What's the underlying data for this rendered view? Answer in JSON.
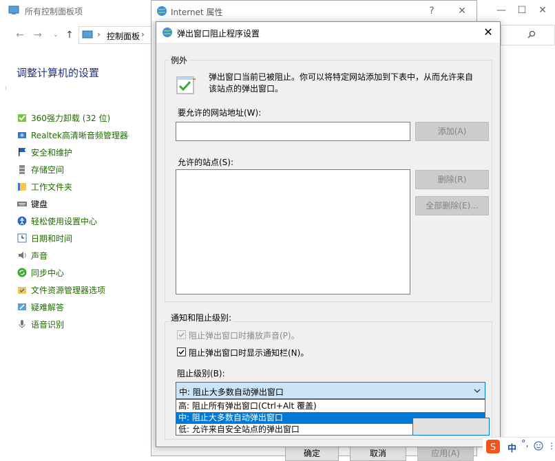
{
  "control_panel": {
    "title": "所有控制面板项",
    "breadcrumb": "控制面板",
    "heading": "调整计算机的设置",
    "items": [
      {
        "label": "360强力卸载 (32 位)",
        "icon": "uninstall-icon"
      },
      {
        "label": "Realtek高清晰音频管理器",
        "icon": "speaker-manager-icon"
      },
      {
        "label": "安全和维护",
        "icon": "flag-icon"
      },
      {
        "label": "存储空间",
        "icon": "storage-icon"
      },
      {
        "label": "工作文件夹",
        "icon": "work-folder-icon"
      },
      {
        "label": "键盘",
        "icon": "keyboard-icon"
      },
      {
        "label": "轻松使用设置中心",
        "icon": "ease-of-access-icon"
      },
      {
        "label": "日期和时间",
        "icon": "clock-icon"
      },
      {
        "label": "声音",
        "icon": "sound-icon"
      },
      {
        "label": "同步中心",
        "icon": "sync-icon"
      },
      {
        "label": "文件资源管理器选项",
        "icon": "folder-options-icon"
      },
      {
        "label": "疑难解答",
        "icon": "troubleshoot-icon"
      },
      {
        "label": "语音识别",
        "icon": "microphone-icon"
      }
    ]
  },
  "ie_window": {
    "title": "Internet 属性",
    "help_glyph": "?",
    "close_glyph": "✕",
    "buttons": {
      "ok": "确定",
      "cancel": "取消",
      "apply": "应用(A)"
    }
  },
  "dialog": {
    "title": "弹出窗口阻止程序设置",
    "close_glyph": "✕",
    "exceptions": {
      "group_label": "例外",
      "description": "弹出窗口当前已被阻止。你可以将特定网站添加到下表中，从而允许来自该站点的弹出窗口。",
      "address_label": "要允许的网站地址(W):",
      "address_value": "",
      "add_button": "添加(A)",
      "allowed_label": "允许的站点(S):",
      "remove_button": "删除(R)",
      "remove_all_button": "全部删除(E)..."
    },
    "notify": {
      "group_label": "通知和阻止级别:",
      "sound_checkbox": "阻止弹出窗口时播放声音(P)。",
      "sound_checked": true,
      "sound_disabled": true,
      "bar_checkbox": "阻止弹出窗口时显示通知栏(N)。",
      "bar_checked": true,
      "level_label": "阻止级别(B):",
      "level_selected": "中: 阻止大多数自动弹出窗口",
      "level_options": [
        "高: 阻止所有弹出窗口(Ctrl+Alt 覆盖)",
        "中: 阻止大多数自动弹出窗口",
        "低: 允许来自安全站点的弹出窗口"
      ],
      "highlighted_option": 1
    }
  },
  "right_window": {
    "minimize_glyph": "—",
    "maximize_glyph": "☐",
    "close_glyph": "✕"
  },
  "ime": {
    "label": "中"
  },
  "colors": {
    "accent": "#0078d7",
    "link_green": "#1f6c00",
    "heading_blue": "#1e3287",
    "dialog_bg": "#f0f0f0"
  }
}
